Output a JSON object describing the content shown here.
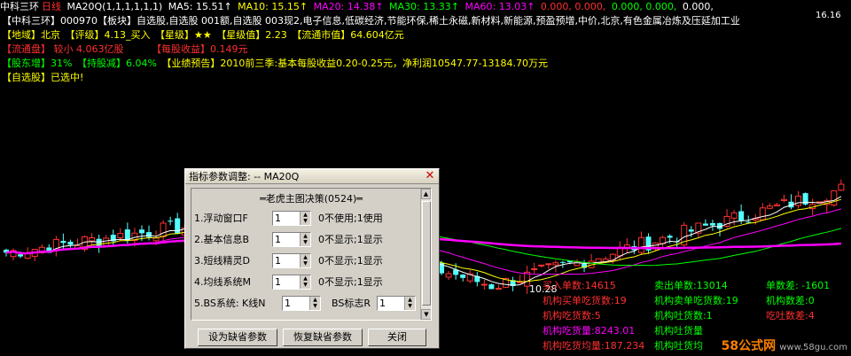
{
  "header": {
    "stock": "中科三环",
    "period": "日线",
    "indicator": "MA20Q(1,1,1,1,1,1)",
    "ma5": "MA5: 15.51↑",
    "ma10": "MA10: 15.15↑",
    "ma20": "MA20: 14.38↑",
    "ma30": "MA30: 13.33↑",
    "ma60": "MA60: 13.03↑",
    "zeros_red": "0.000, 0.000,",
    "zeros_green": "0.000, 0.000,",
    "zeros_white": "0.000,",
    "high_label": "16.16"
  },
  "info": {
    "line1": "【中科三环】000970【板块】自选股,自选股 001额,自选股 003现2,电子信息,低碳经济,节能环保,稀土永磁,新材料,新能源,预盈预增,中价,北京,有色金属冶炼及压延加工业",
    "line2_a": "【地域】北京",
    "line2_b": "【评级】4.13_买入",
    "line2_c": "【星级】★★",
    "line2_d": "【星级值】2.23",
    "line2_e": "【流通市值】64.604亿元",
    "line3_a": "【流通盘】 较小 4.063亿股",
    "line3_b": "【每股收益】0.149元",
    "line4_a": "【股东增】31%",
    "line4_b": "【持股减】6.04%",
    "line4_c": "【业绩预告】2010前三季:基本每股收益0.20-0.25元，净利润10547.77-13184.70万元",
    "line5": "【自选股】已选中!"
  },
  "low_label": "10.28",
  "stats": {
    "buy_count": "买入单数:14615",
    "sell_count": "卖出单数:13014",
    "diff_count": "单数差: -1601",
    "inst_buy_eat": "机构买单吃货数:19",
    "inst_sell_eat": "机构卖单吃货数:19",
    "inst_diff": "机构数差:0",
    "inst_eat": "机构吃货数:5",
    "inst_spit": "机构吐货数:1",
    "eat_spit_diff": "吃吐数差:4",
    "inst_eat_vol": "机构吃货量:8243.01",
    "inst_spit_vol": "机构吐货量",
    "inst_eat_avg": "机构吃货均量:187.234",
    "inst_spit_avg": "机构吐货均"
  },
  "dialog": {
    "title": "指标参数调整: -- MA20Q",
    "panel_title": "═老虎主图决策(0524)═",
    "rows": [
      {
        "label": "1.浮动窗口F",
        "value": "1",
        "desc": "0不使用;1使用"
      },
      {
        "label": "2.基本信息B",
        "value": "1",
        "desc": "0不显示;1显示"
      },
      {
        "label": "3.短线精灵D",
        "value": "1",
        "desc": "0不显示;1显示"
      },
      {
        "label": "4.均线系统M",
        "value": "1",
        "desc": "0不显示;1显示"
      }
    ],
    "row5_label": "5.BS系统: K线N",
    "row5_value": "1",
    "row5_label2": "BS标志R",
    "row5_value2": "1",
    "buttons": {
      "default": "设为缺省参数",
      "restore": "恢复缺省参数",
      "close": "关闭"
    }
  },
  "watermark": {
    "brand": "58公式网",
    "url": "www.58gu.com"
  }
}
